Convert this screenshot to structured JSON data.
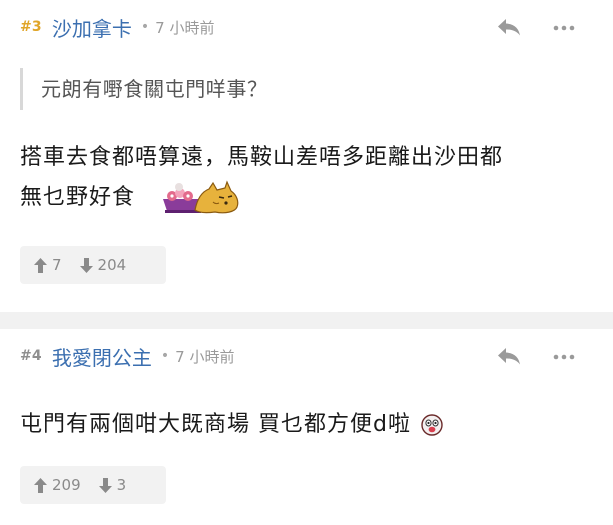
{
  "posts": [
    {
      "number": "#3",
      "number_color": "#e0a528",
      "username": "沙加拿卡",
      "separator": "•",
      "time": "7 小時前",
      "quote": "元朗有嘢食關屯門咩事？",
      "body_lines": [
        "搭車去食都唔算遠，馬鞍山差唔多距離出沙田都",
        "無乜野好食"
      ],
      "emoji": "dog-icon",
      "upvotes": "7",
      "downvotes": "204"
    },
    {
      "number": "#4",
      "number_color": "#8f8f8f",
      "username": "我愛閉公主",
      "separator": "•",
      "time": "7 小時前",
      "body_lines": [
        "屯門有兩個咁大既商場 買乜都方便d啦"
      ],
      "emoji": "surprised-face-icon",
      "upvotes": "209",
      "downvotes": "3"
    }
  ],
  "colors": {
    "username": "#3b6fb0",
    "meta": "#9a9a9a",
    "vote_bg": "#f2f2f2",
    "separator_bg": "#f1f1f1"
  }
}
